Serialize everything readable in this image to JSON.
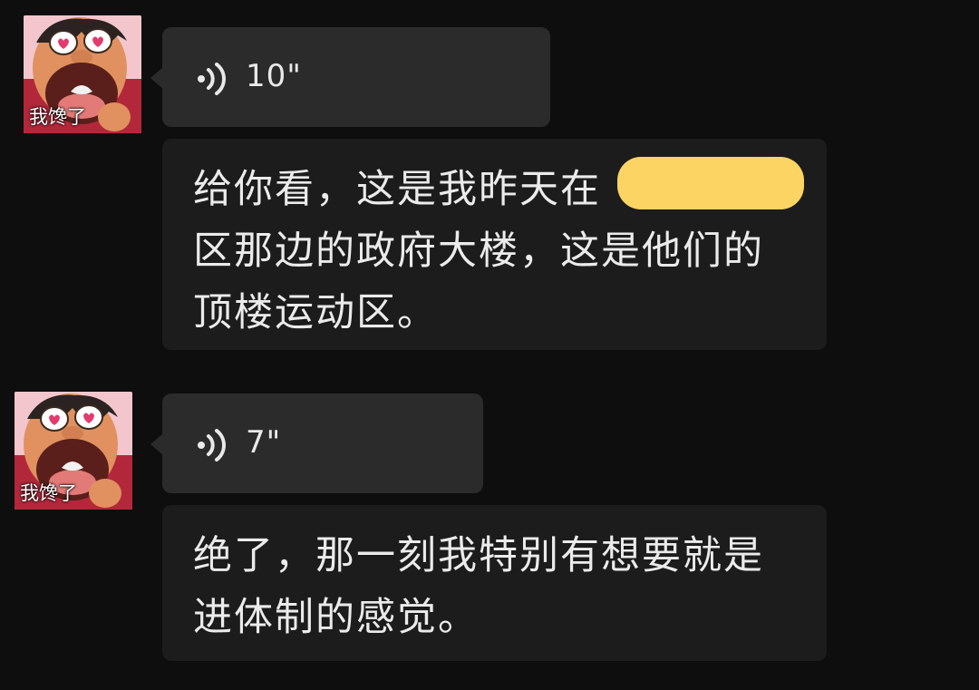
{
  "messages": [
    {
      "sender": {
        "avatar_caption": "我馋了"
      },
      "voice": {
        "duration": "10\""
      },
      "transcription": {
        "lines": [
          "给你看，这是我昨天在",
          "区那边的政府大楼，这是他们的",
          "顶楼运动区。"
        ]
      }
    },
    {
      "sender": {
        "avatar_caption": "我馋了"
      },
      "voice": {
        "duration": "7\""
      },
      "transcription": {
        "lines": [
          "绝了，那一刻我特别有想要就是",
          "进体制的感觉。"
        ]
      }
    }
  ],
  "colors": {
    "background": "#0e0e0e",
    "voice_bubble": "#2b2b2b",
    "text_bubble": "#1c1c1c",
    "redaction": "#fcd463"
  },
  "icons": {
    "voice": "voice-wave-icon"
  }
}
